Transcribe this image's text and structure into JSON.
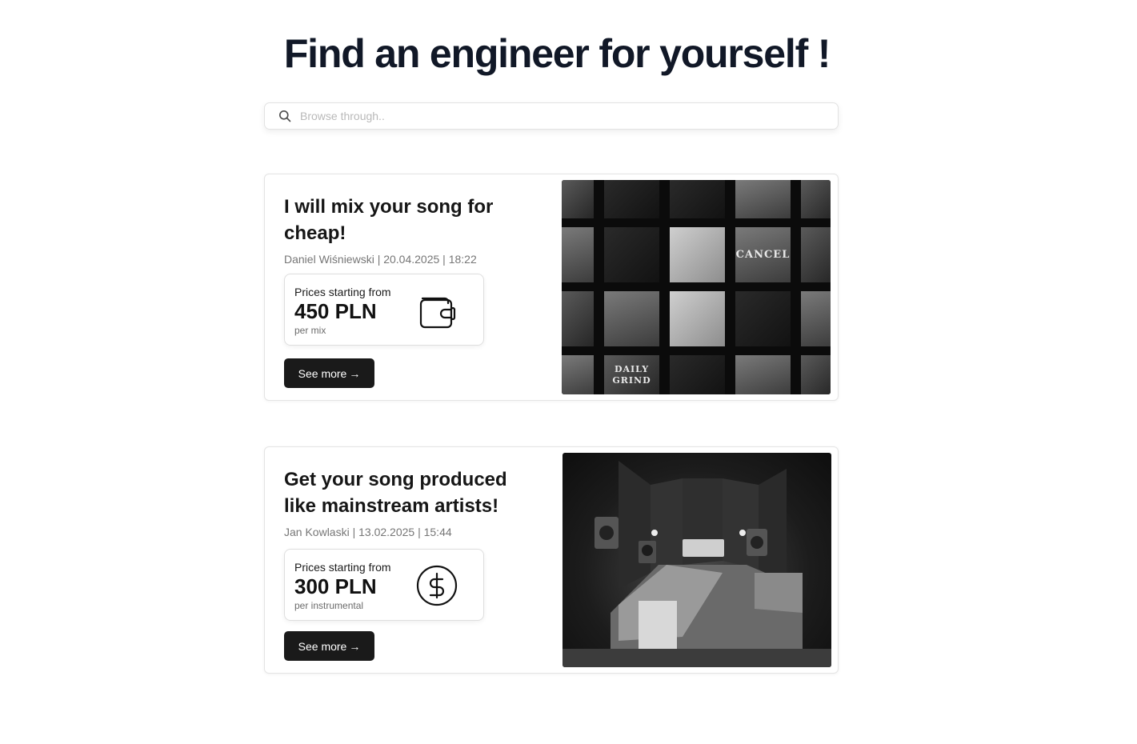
{
  "page": {
    "title": "Find an engineer for yourself !"
  },
  "search": {
    "placeholder": "Browse through.."
  },
  "listings": [
    {
      "title": "I will mix your song for cheap!",
      "meta": "Daniel Wiśniewski | 20.04.2025 | 18:22",
      "price_label": "Prices starting from",
      "price": "450 PLN",
      "price_unit": "per mix",
      "price_icon": "wallet-icon",
      "button_label": "See more",
      "image": "album-covers-collage",
      "image_text": [
        "CANCEL",
        "DAILY GRIND"
      ]
    },
    {
      "title": "Get your song produced like mainstream artists!",
      "meta": "Jan Kowlaski | 13.02.2025 | 15:44",
      "price_label": "Prices starting from",
      "price": "300 PLN",
      "price_unit": "per instrumental",
      "price_icon": "dollar-circle-icon",
      "button_label": "See more",
      "image": "recording-studio-photo"
    }
  ]
}
